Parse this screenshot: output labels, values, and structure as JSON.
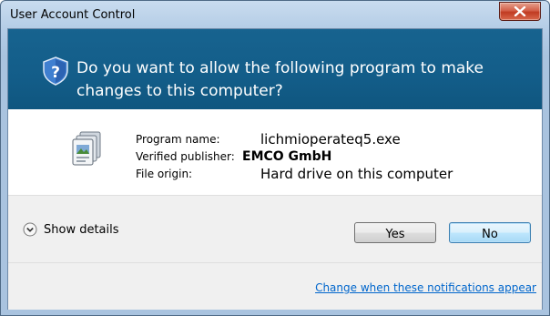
{
  "window": {
    "title": "User Account Control",
    "close_icon": "close-icon"
  },
  "banner": {
    "icon": "shield-question-icon",
    "question": "Do you want to allow the following program to make changes to this computer?"
  },
  "program": {
    "icon": "program-icon",
    "name_label": "Program name:",
    "name_value": "lichmioperateq5.exe",
    "publisher_label": "Verified publisher:",
    "publisher_value": "EMCO GmbH",
    "origin_label": "File origin:",
    "origin_value": "Hard drive on this computer"
  },
  "actions": {
    "details_label": "Show details",
    "details_icon": "chevron-down-icon",
    "yes_label": "Yes",
    "no_label": "No"
  },
  "footer": {
    "link_text": "Change when these notifications appear"
  },
  "colors": {
    "banner": "#135d89",
    "link": "#0066cc",
    "close_button": "#c7432a"
  }
}
